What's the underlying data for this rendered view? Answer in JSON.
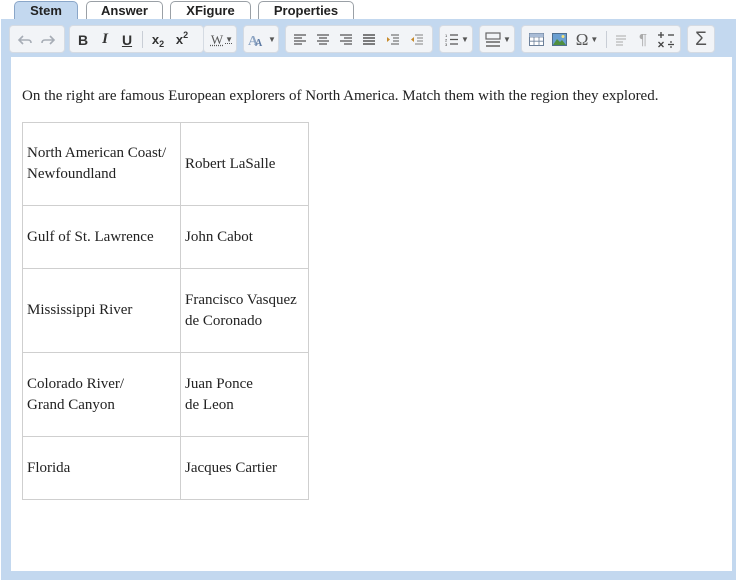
{
  "tabs": [
    {
      "label": "Stem",
      "active": true
    },
    {
      "label": "Answer",
      "active": false
    },
    {
      "label": "XFigure",
      "active": false
    },
    {
      "label": "Properties",
      "active": false
    }
  ],
  "toolbar": {
    "icons": [
      "undo-icon",
      "redo-icon",
      "bold-icon",
      "italic-icon",
      "underline-icon",
      "subscript-icon",
      "superscript-icon",
      "text-style-icon",
      "font-size-icon",
      "align-left-icon",
      "align-center-icon",
      "align-right-icon",
      "align-justify-icon",
      "indent-icon",
      "outdent-icon",
      "numbered-list-icon",
      "insert-block-icon",
      "table-icon",
      "image-icon",
      "special-character-icon",
      "paragraph-icon",
      "pilcrow-icon",
      "math-ops-icon",
      "sigma-icon"
    ],
    "bold": "B",
    "italic": "I",
    "underline": "U",
    "subscript": "x",
    "subscript_mark": "2",
    "superscript": "x",
    "superscript_mark": "2",
    "text_style": "W",
    "omega": "Ω",
    "pilcrow": "¶",
    "sigma": "Σ"
  },
  "content": {
    "prompt": "On the right are famous European explorers of North America. Match them with the region they explored.",
    "rows": [
      {
        "region": [
          "North American Coast/",
          "Newfoundland"
        ],
        "explorer": [
          "Robert LaSalle"
        ]
      },
      {
        "region": [
          "Gulf of St. Lawrence"
        ],
        "explorer": [
          "John Cabot"
        ]
      },
      {
        "region": [
          "Mississippi River"
        ],
        "explorer": [
          "Francisco Vasquez",
          "de Coronado"
        ]
      },
      {
        "region": [
          "Colorado River/",
          "Grand Canyon"
        ],
        "explorer": [
          "Juan Ponce",
          "de Leon"
        ]
      },
      {
        "region": [
          "Florida"
        ],
        "explorer": [
          "Jacques Cartier"
        ]
      }
    ]
  },
  "colors": {
    "frame": "#c3d8ef",
    "tab_active": "#c3d8ef",
    "table_border": "#cfcfcf"
  }
}
